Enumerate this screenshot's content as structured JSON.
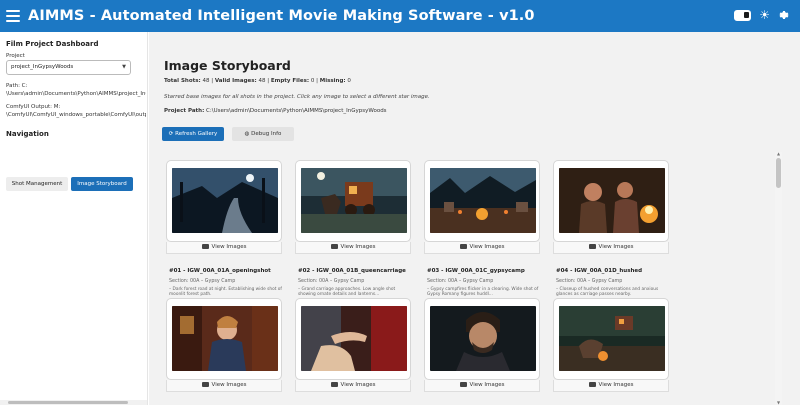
{
  "app": {
    "title": "AIMMS - Automated Intelligent Movie Making Software - v1.0",
    "menu_icon": "hamburger-icon",
    "theme_icon": "sun-icon",
    "settings_icon": "gear-icon",
    "brand_color": "#1c78c4"
  },
  "sidebar": {
    "dashboard_title": "Film Project Dashboard",
    "project_label": "Project",
    "project_value": "project_InGypsyWoods",
    "path_label": "Path: C:",
    "path_value": "\\Users\\admin\\Documents\\Python\\AIMMS\\project_InG",
    "comfy_label": "ComfyUI Output: M:",
    "comfy_value": "\\ComfyUI\\ComfyUI_windows_portable\\ComfyUI\\outpu",
    "nav_title": "Navigation",
    "nav_shot_management": "Shot Management",
    "nav_image_storyboard": "Image Storyboard"
  },
  "main": {
    "title": "Image Storyboard",
    "stats": {
      "total_label": "Total Shots:",
      "total": "48",
      "valid_label": "Valid Images:",
      "valid": "48",
      "empty_label": "Empty Files:",
      "empty": "0",
      "missing_label": "Missing:",
      "missing": "0"
    },
    "hint": "Starred base images for all shots in the project. Click any image to select a different star image.",
    "project_path_label": "Project Path:",
    "project_path_value": "C:\\Users\\admin\\Documents\\Python\\AIMMS\\project_InGypsyWoods",
    "refresh_label": "Refresh Gallery",
    "debug_label": "Debug Info",
    "view_images_label": "View Images"
  },
  "shots": [
    {
      "label": "#01 - IGW_00A_01A_openingshot",
      "section": "Section: 00A – Gypsy Camp",
      "desc": "– Dark forest road at night. Establishing wide shot of",
      "desc2": "moonlit forest path.",
      "image": "moonlit-forest-road"
    },
    {
      "label": "#02 - IGW_00A_01B_queencarriage",
      "section": "Section: 00A – Gypsy Camp",
      "desc": "– Grand carriage approaches. Low angle shot",
      "desc2": "showing ornate details and lanterns...",
      "image": "carriage-with-horses"
    },
    {
      "label": "#03 - IGW_00A_01C_gypsycamp",
      "section": "Section: 00A – Gypsy Camp",
      "desc": "– Gypsy campfires flicker in a clearing. Wide shot of",
      "desc2": "Gypsy Romany figures huddl...",
      "image": "gypsy-campfire-clearing"
    },
    {
      "label": "#04 - IGW_00A_01D_hushed",
      "section": "Section: 00A – Gypsy Camp",
      "desc": "– Closeup of hushed conversations and anxious",
      "desc2": "glances as carriage passes nearby.",
      "image": "women-by-fire"
    },
    {
      "image": "noblewoman-in-carriage"
    },
    {
      "image": "hand-reaching-curtain"
    },
    {
      "image": "man-portrait"
    },
    {
      "image": "campfire-with-carriage"
    }
  ]
}
